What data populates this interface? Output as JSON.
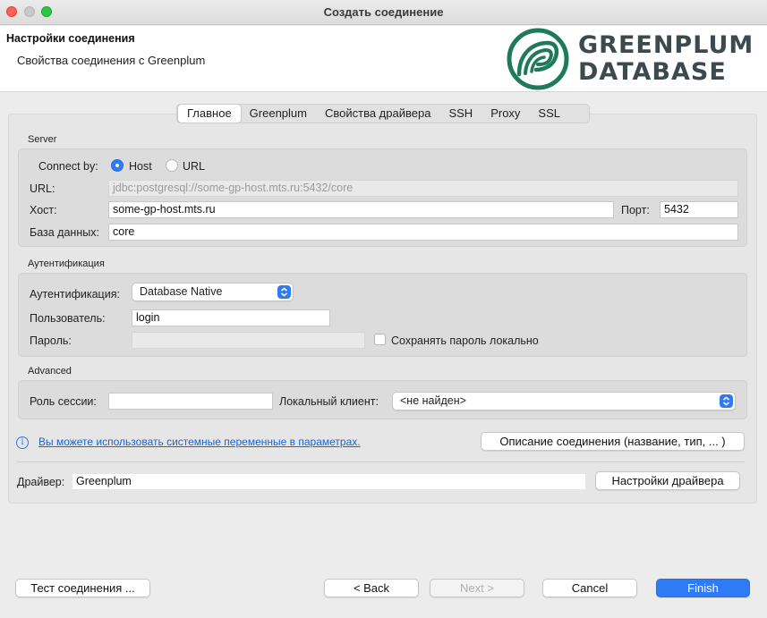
{
  "window": {
    "title": "Создать соединение"
  },
  "header": {
    "title": "Настройки соединения",
    "subtitle": "Свойства соединения с Greenplum",
    "logo_line1": "GREENPLUM",
    "logo_line2": "DATABASE"
  },
  "tabs": [
    {
      "label": "Главное",
      "active": true
    },
    {
      "label": "Greenplum",
      "active": false
    },
    {
      "label": "Свойства драйвера",
      "active": false
    },
    {
      "label": "SSH",
      "active": false
    },
    {
      "label": "Proxy",
      "active": false
    },
    {
      "label": "SSL",
      "active": false
    }
  ],
  "server": {
    "section_label": "Server",
    "connect_by_label": "Connect by:",
    "host_option": "Host",
    "url_option": "URL",
    "selected": "Host",
    "url_label": "URL:",
    "url_value": "jdbc:postgresql://some-gp-host.mts.ru:5432/core",
    "host_label": "Хост:",
    "host_value": "some-gp-host.mts.ru",
    "port_label": "Порт:",
    "port_value": "5432",
    "db_label": "База данных:",
    "db_value": "core"
  },
  "auth": {
    "section_label": "Аутентификация",
    "auth_label": "Аутентификация:",
    "auth_value": "Database Native",
    "user_label": "Пользователь:",
    "user_value": "login",
    "password_label": "Пароль:",
    "password_value": "",
    "save_password_label": "Сохранять пароль локально",
    "save_password_checked": false
  },
  "advanced": {
    "section_label": "Advanced",
    "role_label": "Роль сессии:",
    "role_value": "",
    "client_label": "Локальный клиент:",
    "client_value": "<не найден>"
  },
  "info": {
    "link_text": "Вы можете использовать системные переменные в параметрах.",
    "describe_button": "Описание соединения (название, тип, ... )"
  },
  "driver": {
    "label": "Драйвер:",
    "value": "Greenplum",
    "settings_button": "Настройки драйвера"
  },
  "footer": {
    "test_button": "Тест соединения ...",
    "back_button": "< Back",
    "next_button": "Next >",
    "cancel_button": "Cancel",
    "finish_button": "Finish"
  },
  "colors": {
    "accent": "#2f7bf5",
    "logo_green": "#1f7a5c",
    "logo_text": "#3c4a4e"
  }
}
